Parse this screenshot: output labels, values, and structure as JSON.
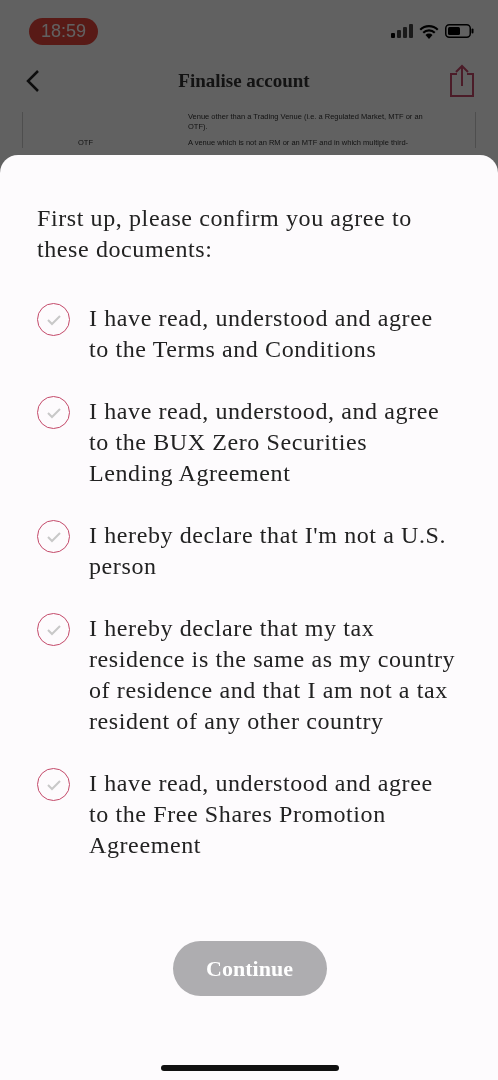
{
  "status_bar": {
    "time": "18:59"
  },
  "nav": {
    "title": "Finalise account"
  },
  "document": {
    "rows": [
      {
        "term": "",
        "definition": "Venue other than a Trading Venue (i.e. a Regulated Market, MTF or an OTF)."
      },
      {
        "term": "OTF",
        "definition": "A venue which is not an RM or an MTF and in which multiple third-"
      }
    ]
  },
  "sheet": {
    "heading": "First up, please confirm you agree to these documents:",
    "agreements": [
      {
        "text": "I have read, understood and agree to the Terms and Conditions",
        "checked": false
      },
      {
        "text": "I have read, understood, and agree to the BUX Zero Securities Lending Agreement",
        "checked": false
      },
      {
        "text": "I hereby declare that I'm not a U.S. person",
        "checked": false
      },
      {
        "text": "I hereby declare that my tax residence is the same as my country of residence and that I am not a tax resident of any other country",
        "checked": false
      },
      {
        "text": "I have read, understood and agree to the Free Shares Promotion Agreement",
        "checked": false
      }
    ],
    "continue_button": {
      "label": "Continue",
      "disabled": true
    }
  }
}
